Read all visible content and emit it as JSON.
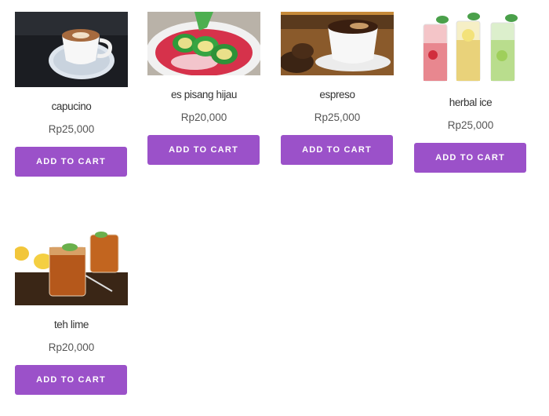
{
  "products": [
    {
      "name": "capucino",
      "price": "Rp25,000",
      "button": "ADD TO CART",
      "image": "cappuccino-cup-image"
    },
    {
      "name": "es pisang hijau",
      "price": "Rp20,000",
      "button": "ADD TO CART",
      "image": "es-pisang-hijau-bowl-image"
    },
    {
      "name": "espreso",
      "price": "Rp25,000",
      "button": "ADD TO CART",
      "image": "espresso-cup-beans-image"
    },
    {
      "name": "herbal ice",
      "price": "Rp25,000",
      "button": "ADD TO CART",
      "image": "herbal-ice-glasses-image"
    },
    {
      "name": "teh lime",
      "price": "Rp20,000",
      "button": "ADD TO CART",
      "image": "iced-lime-tea-image"
    }
  ],
  "colors": {
    "button_bg": "#9b51c9",
    "button_text": "#ffffff"
  }
}
